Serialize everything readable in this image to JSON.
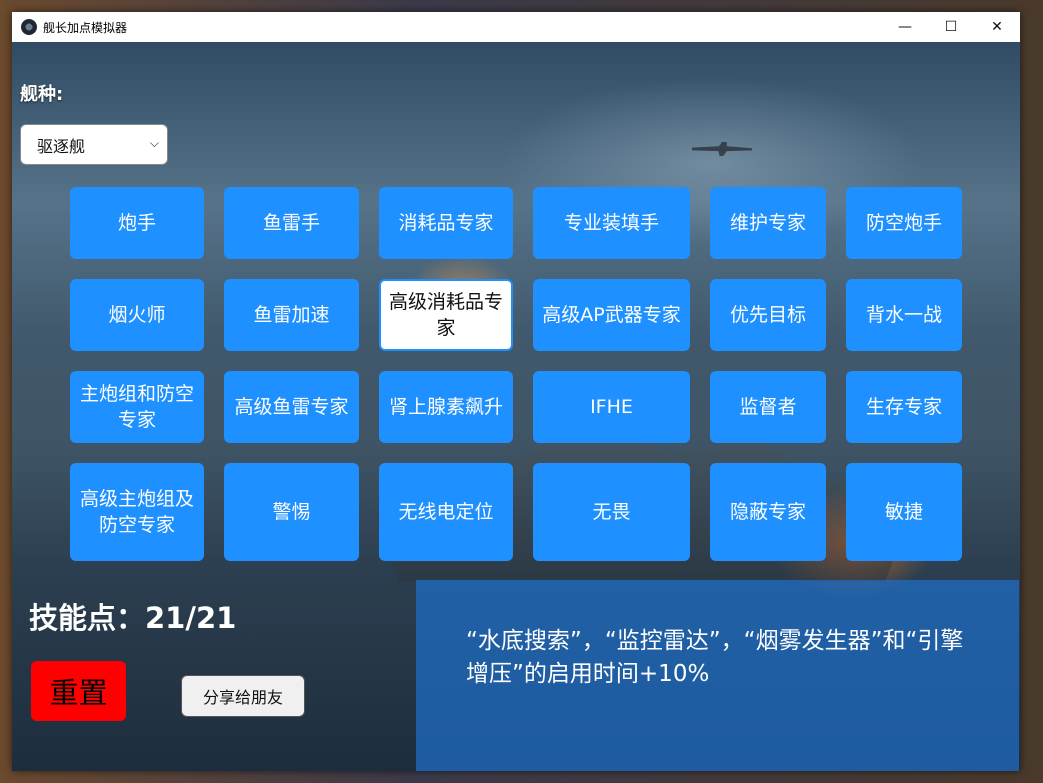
{
  "window": {
    "title": "舰长加点模拟器"
  },
  "ship_class": {
    "label": "舰种:",
    "selected": "驱逐舰"
  },
  "skills": [
    {
      "label": "炮手"
    },
    {
      "label": "鱼雷手"
    },
    {
      "label": "消耗品专家"
    },
    {
      "label": "专业装填手"
    },
    {
      "label": "维护专家"
    },
    {
      "label": "防空炮手"
    },
    {
      "label": "烟火师"
    },
    {
      "label": "鱼雷加速"
    },
    {
      "label": "高级消耗品专家",
      "selected": true
    },
    {
      "label": "高级AP武器专家"
    },
    {
      "label": "优先目标"
    },
    {
      "label": "背水一战"
    },
    {
      "label": "主炮组和防空专家"
    },
    {
      "label": "高级鱼雷专家"
    },
    {
      "label": "肾上腺素飙升"
    },
    {
      "label": "IFHE"
    },
    {
      "label": "监督者"
    },
    {
      "label": "生存专家"
    },
    {
      "label": "高级主炮组及防空专家"
    },
    {
      "label": "警惕"
    },
    {
      "label": "无线电定位"
    },
    {
      "label": "无畏"
    },
    {
      "label": "隐蔽专家"
    },
    {
      "label": "敏捷"
    }
  ],
  "skill_points": "技能点：21/21",
  "reset_label": "重置",
  "share_label": "分享给朋友",
  "description": "“水底搜索”，“监控雷达”，“烟雾发生器”和“引擎增压”的启用时间+10%",
  "colors": {
    "skill_button": "#1e90ff",
    "reset_button": "#ff0000",
    "description_panel": "#1e6ec8"
  }
}
